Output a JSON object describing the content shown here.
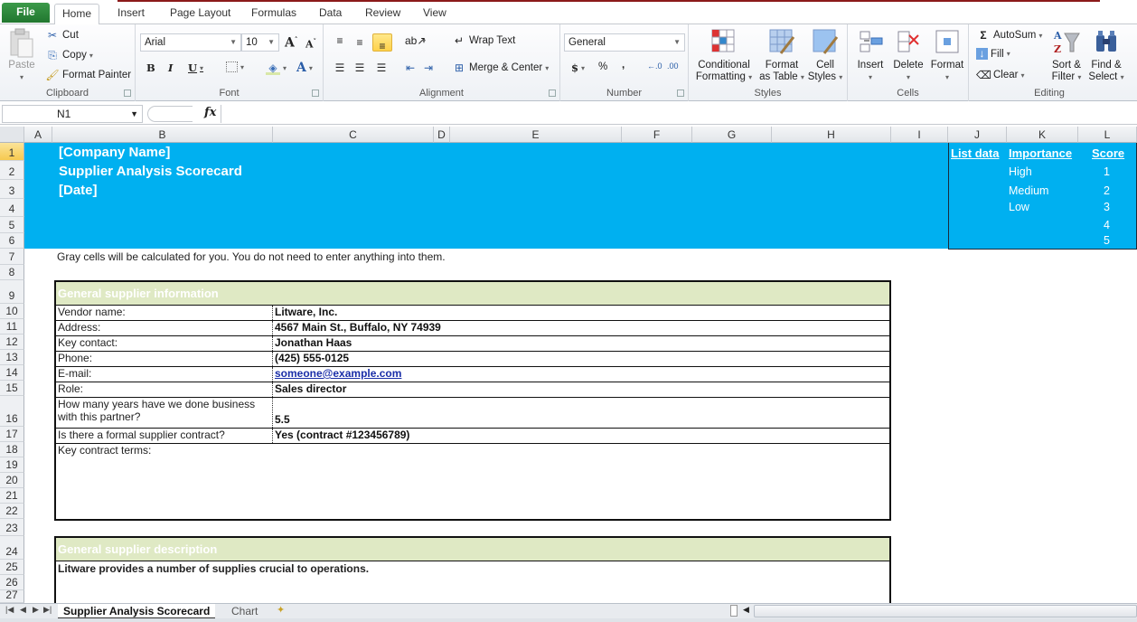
{
  "ribbon_tabs": [
    "File",
    "Home",
    "Insert",
    "Page Layout",
    "Formulas",
    "Data",
    "Review",
    "View"
  ],
  "active_tab": "Home",
  "clipboard": {
    "paste": "Paste",
    "cut": "Cut",
    "copy": "Copy",
    "format_painter": "Format Painter",
    "label": "Clipboard"
  },
  "font": {
    "family": "Arial",
    "size": "10",
    "label": "Font",
    "bold": "B",
    "italic": "I",
    "underline": "U"
  },
  "alignment": {
    "wrap_text": "Wrap Text",
    "merge_center": "Merge & Center",
    "label": "Alignment"
  },
  "number": {
    "format": "General",
    "currency": "$",
    "percent": "%",
    "comma": ",",
    "label": "Number"
  },
  "styles": {
    "conditional": "Conditional",
    "conditional2": "Formatting",
    "format_table": "Format",
    "format_table2": "as Table",
    "cell_styles": "Cell",
    "cell_styles2": "Styles",
    "label": "Styles"
  },
  "cells": {
    "insert": "Insert",
    "delete": "Delete",
    "format": "Format",
    "label": "Cells"
  },
  "editing": {
    "autosum": "AutoSum",
    "fill": "Fill",
    "clear": "Clear",
    "sort": "Sort &",
    "sort2": "Filter",
    "find": "Find &",
    "find2": "Select",
    "label": "Editing"
  },
  "formula_bar": {
    "name_box": "N1",
    "fx": "fx",
    "content": ""
  },
  "columns": [
    "A",
    "B",
    "C",
    "D",
    "E",
    "F",
    "G",
    "H",
    "I",
    "J",
    "K",
    "L"
  ],
  "rows": [
    "1",
    "2",
    "3",
    "4",
    "5",
    "6",
    "7",
    "8",
    "9",
    "10",
    "11",
    "12",
    "13",
    "14",
    "15",
    "16",
    "17",
    "18",
    "19",
    "20",
    "21",
    "22",
    "23",
    "24",
    "25",
    "26",
    "27"
  ],
  "banner": {
    "company": "[Company Name]",
    "title": "Supplier Analysis Scorecard",
    "date": "[Date]",
    "color": "#00b0f0"
  },
  "list_data": {
    "header_list": "List data",
    "header_importance": "Importance",
    "header_score": "Score",
    "importance": [
      "High",
      "Medium",
      "Low"
    ],
    "score": [
      "1",
      "2",
      "3",
      "4",
      "5"
    ]
  },
  "note": "Gray cells will be calculated for you. You do not need to enter anything into them.",
  "general_info": {
    "title": "General supplier information",
    "rows": [
      {
        "label": "Vendor name:",
        "value": "Litware, Inc."
      },
      {
        "label": "Address:",
        "value": "4567 Main St., Buffalo, NY 74939"
      },
      {
        "label": "Key contact:",
        "value": "Jonathan Haas"
      },
      {
        "label": "Phone:",
        "value": "(425) 555-0125"
      },
      {
        "label": "E-mail:",
        "value": "someone@example.com"
      },
      {
        "label": "Role:",
        "value": "Sales director"
      },
      {
        "label": "How many years have we done business",
        "label2": "with this partner?",
        "value": "5.5"
      },
      {
        "label": "Is there a formal supplier contract?",
        "value": "Yes (contract #123456789)"
      },
      {
        "label": "Key contract terms:",
        "value": ""
      }
    ]
  },
  "description": {
    "title": "General supplier description",
    "text": "Litware provides a number of supplies crucial to operations."
  },
  "sheet_tabs": [
    "Supplier Analysis Scorecard",
    "Chart"
  ],
  "active_sheet": "Supplier Analysis Scorecard"
}
